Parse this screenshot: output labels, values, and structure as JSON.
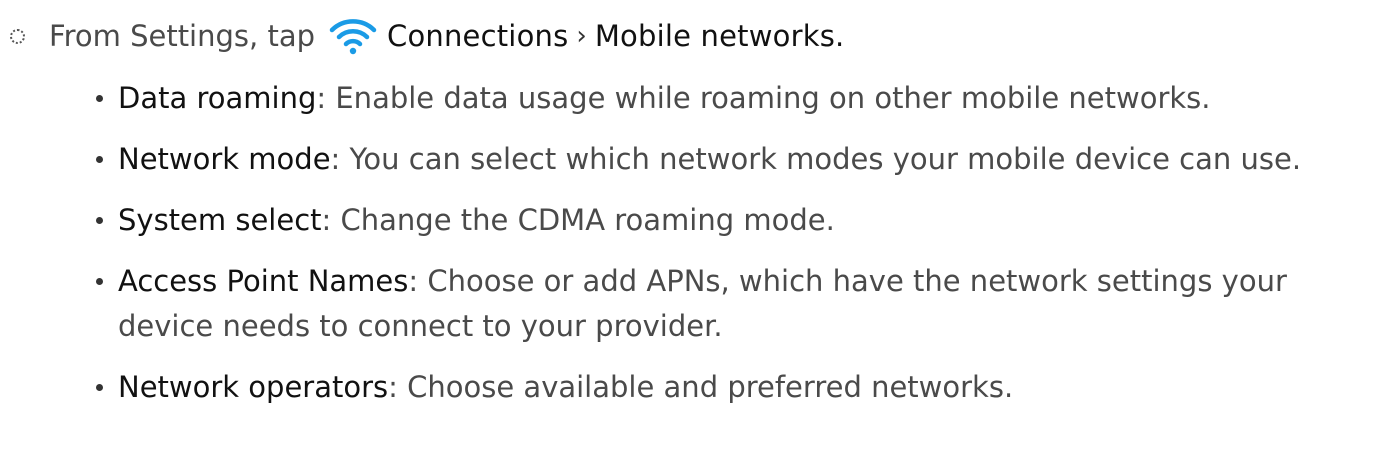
{
  "step": {
    "prefix": "From Settings, tap",
    "icon": "wifi-icon",
    "term_1": "Connections",
    "separator": "›",
    "term_2": "Mobile networks",
    "suffix": "."
  },
  "items": [
    {
      "term": "Data roaming",
      "description": "Enable data usage while roaming on other mobile networks."
    },
    {
      "term": "Network mode",
      "description": "You can select which network modes your mobile device can use."
    },
    {
      "term": "System select",
      "description": "Change the CDMA roaming mode."
    },
    {
      "term": "Access Point Names",
      "description": "Choose or add APNs, which have the network settings your device needs to connect to your provider."
    },
    {
      "term": "Network operators",
      "description": "Choose available and preferred networks."
    }
  ],
  "colors": {
    "icon": "#1a9be6",
    "body_text": "#4a4a4a",
    "term_text": "#111111"
  }
}
